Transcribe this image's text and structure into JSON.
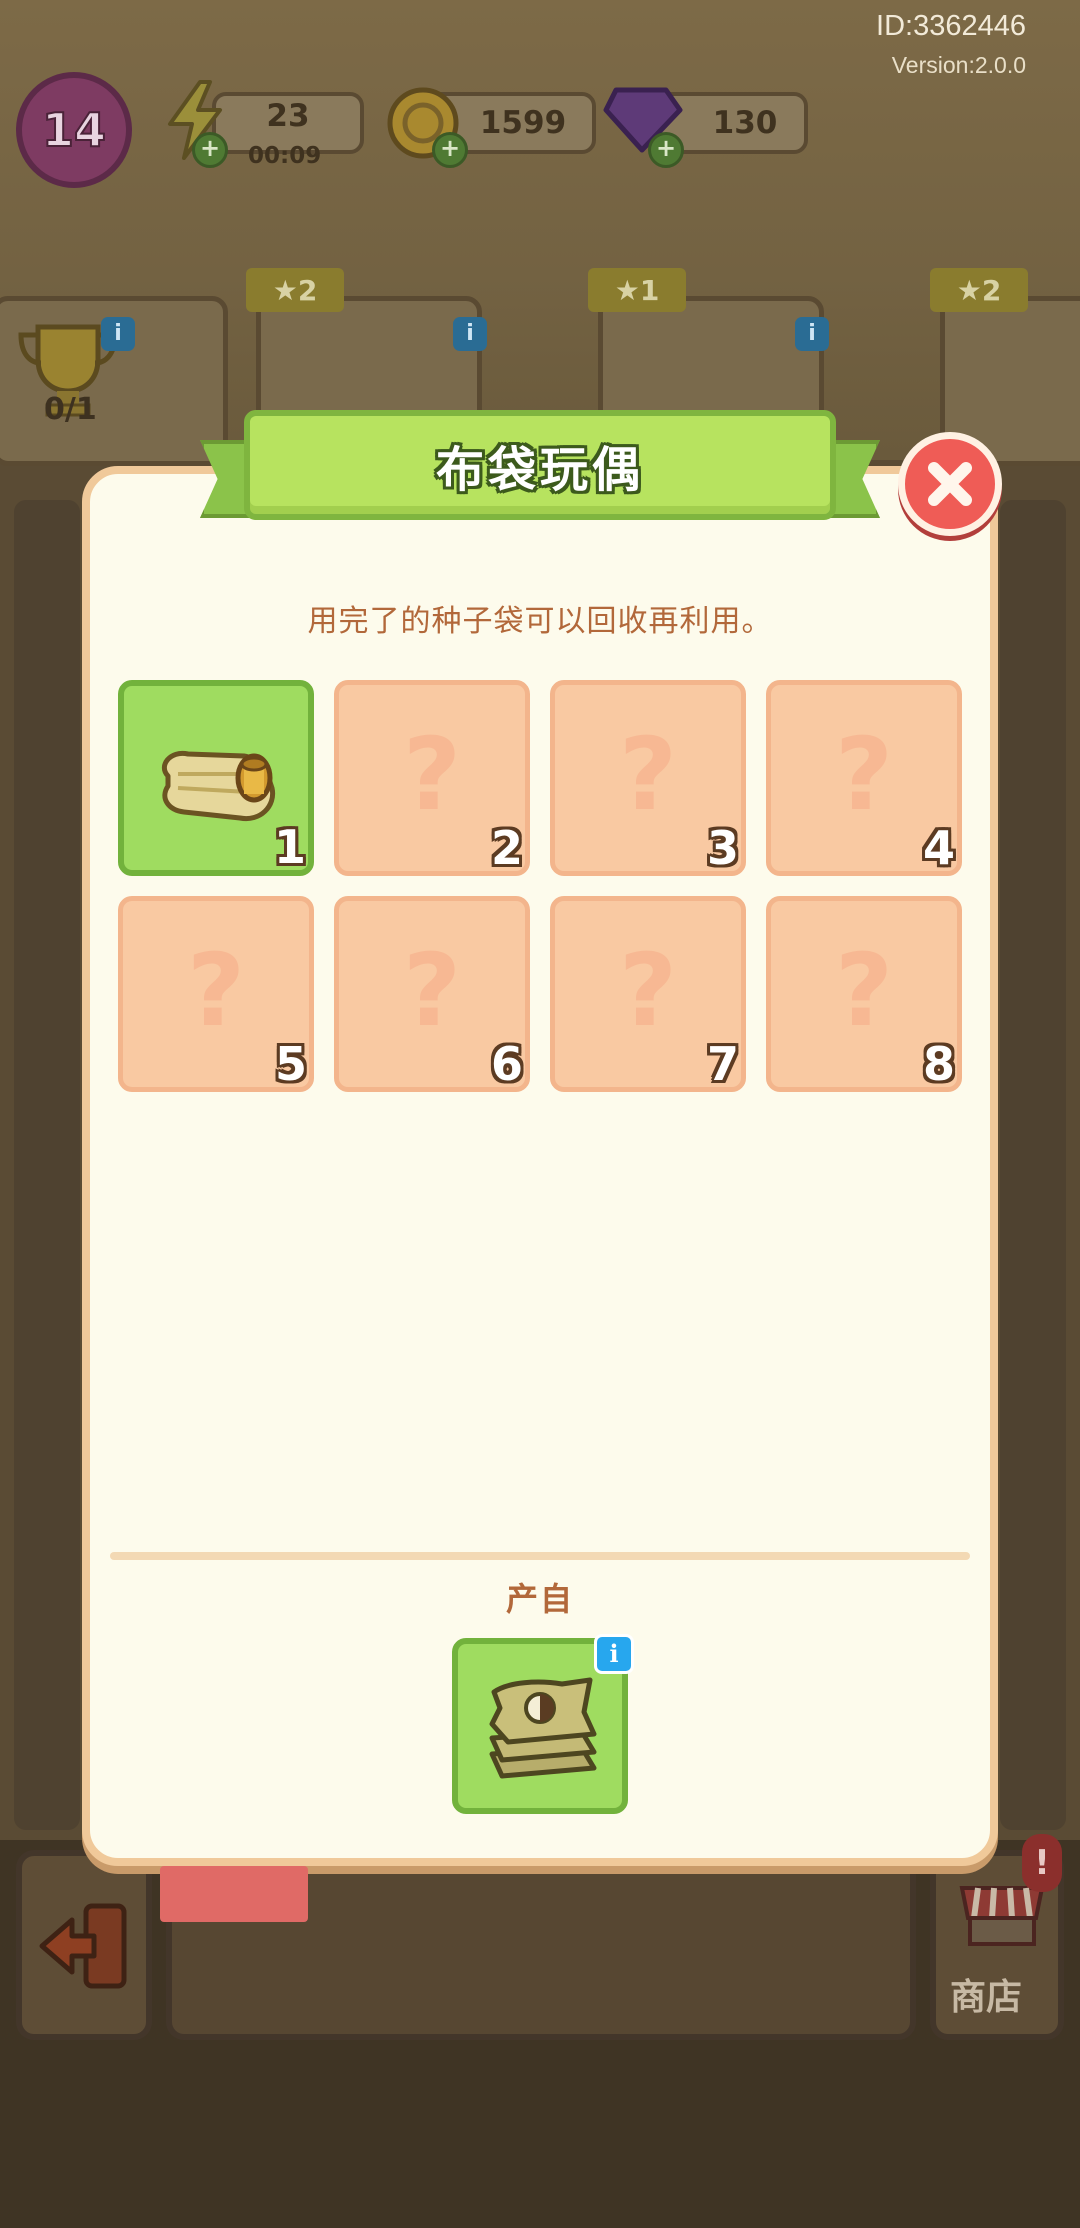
{
  "header": {
    "id_text": "ID:3362446",
    "version_text": "Version:2.0.0",
    "level": "14",
    "energy": "23",
    "energy_timer": "00:09",
    "coins": "1599",
    "gems": "130"
  },
  "quests": {
    "trophy_count": "0/1",
    "stars": [
      "2",
      "1",
      "2"
    ]
  },
  "modal": {
    "title": "布袋玩偶",
    "description": "用完了的种子袋可以回收再利用。",
    "slots": [
      {
        "num": "1",
        "unlocked": true,
        "icon": "scroll-spool-icon"
      },
      {
        "num": "2",
        "unlocked": false,
        "icon": "question-icon"
      },
      {
        "num": "3",
        "unlocked": false,
        "icon": "question-icon"
      },
      {
        "num": "4",
        "unlocked": false,
        "icon": "question-icon"
      },
      {
        "num": "5",
        "unlocked": false,
        "icon": "question-icon"
      },
      {
        "num": "6",
        "unlocked": false,
        "icon": "question-icon"
      },
      {
        "num": "7",
        "unlocked": false,
        "icon": "question-icon"
      },
      {
        "num": "8",
        "unlocked": false,
        "icon": "question-icon"
      }
    ],
    "qmark": "?",
    "source_title": "产自",
    "source_item_icon": "seed-bag-stack-icon",
    "info_glyph": "i"
  },
  "bottom": {
    "shop_label": "商店",
    "alert": "!"
  },
  "colors": {
    "panel_bg": "#fdfbec",
    "panel_border": "#f0c99a",
    "unlocked_green": "#9fdc60",
    "locked_peach": "#f9c9a2",
    "banner_green": "#b7e35f",
    "close_red": "#ef5c56",
    "text_brown": "#b2683a"
  }
}
